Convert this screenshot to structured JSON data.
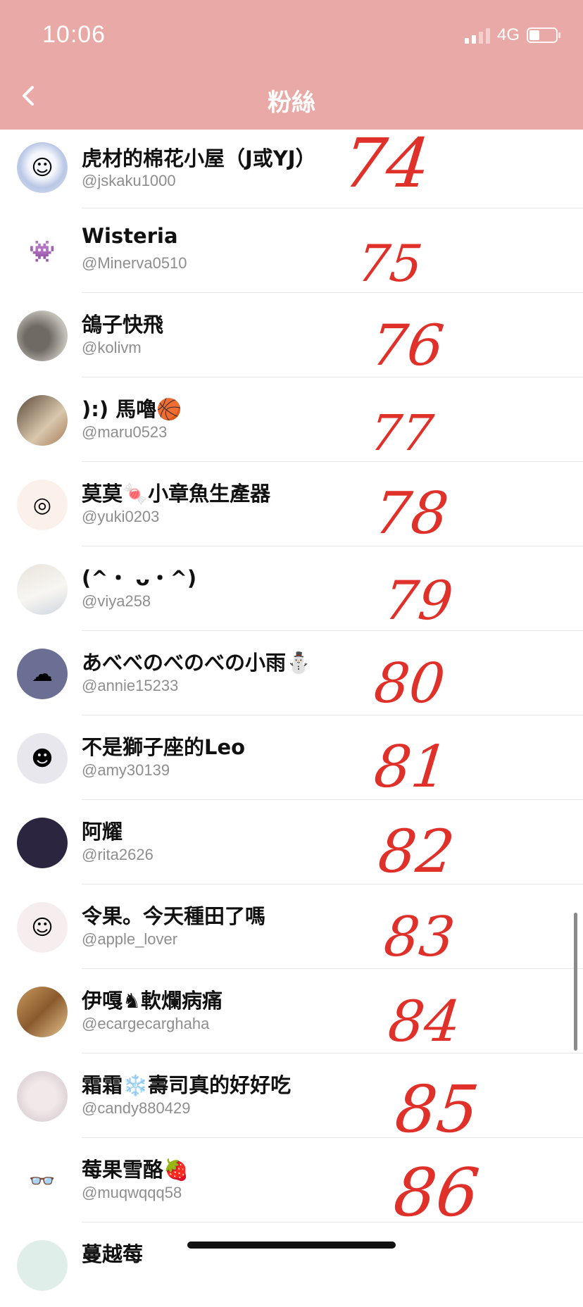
{
  "status": {
    "time": "10:06",
    "network": "4G",
    "signal_bars_lit": 2,
    "signal_bars_total": 4,
    "battery_level": 0.4
  },
  "header": {
    "title": "粉絲",
    "back_icon": "chevron-left-icon",
    "color": "#e9aaa7"
  },
  "annotation_color": "#e0302a",
  "followers": [
    {
      "name": "虎材的棉花小屋（J或YJ）",
      "handle": "@jskaku1000",
      "annotation": "74",
      "avatar_icon": "plush-doll-avatar"
    },
    {
      "name": "Wisteria",
      "handle": "@Minerva0510",
      "annotation": "75",
      "avatar_icon": "ghost-monster-avatar"
    },
    {
      "name": "鴿子快飛",
      "handle": "@kolivm",
      "annotation": "76",
      "avatar_icon": "plush-pair-avatar"
    },
    {
      "name": "):) 馬嚕🏀",
      "handle": "@maru0523",
      "annotation": "77",
      "avatar_icon": "photo-avatar"
    },
    {
      "name": "莫莫🍬小章魚生產器",
      "handle": "@yuki0203",
      "annotation": "78",
      "avatar_icon": "swirl-avatar"
    },
    {
      "name": "(^・ ᴗ・^)",
      "handle": "@viya258",
      "annotation": "79",
      "avatar_icon": "cat-plush-avatar"
    },
    {
      "name": "あべべのべのべの小雨⛄",
      "handle": "@annie15233",
      "annotation": "80",
      "avatar_icon": "storm-cloud-avatar"
    },
    {
      "name": "不是獅子座的Leo",
      "handle": "@amy30139",
      "annotation": "81",
      "avatar_icon": "cartoon-girl-avatar"
    },
    {
      "name": "阿耀",
      "handle": "@rita2626",
      "annotation": "82",
      "avatar_icon": "purple-character-avatar"
    },
    {
      "name": "令果。今天種田了嗎",
      "handle": "@apple_lover",
      "annotation": "83",
      "avatar_icon": "cartoon-character-avatar"
    },
    {
      "name": "伊嘎♞軟爛病痛",
      "handle": "@ecargecarghaha",
      "annotation": "84",
      "avatar_icon": "plush-autumn-avatar"
    },
    {
      "name": "霜霜❄️壽司真的好好吃",
      "handle": "@candy880429",
      "annotation": "85",
      "avatar_icon": "doll-avatar"
    },
    {
      "name": "莓果雪酪🍓",
      "handle": "@muqwqqq58",
      "annotation": "86",
      "avatar_icon": "pink-face-avatar"
    },
    {
      "name": "蔓越莓",
      "handle": "",
      "annotation": "",
      "avatar_icon": "partial-avatar"
    }
  ]
}
